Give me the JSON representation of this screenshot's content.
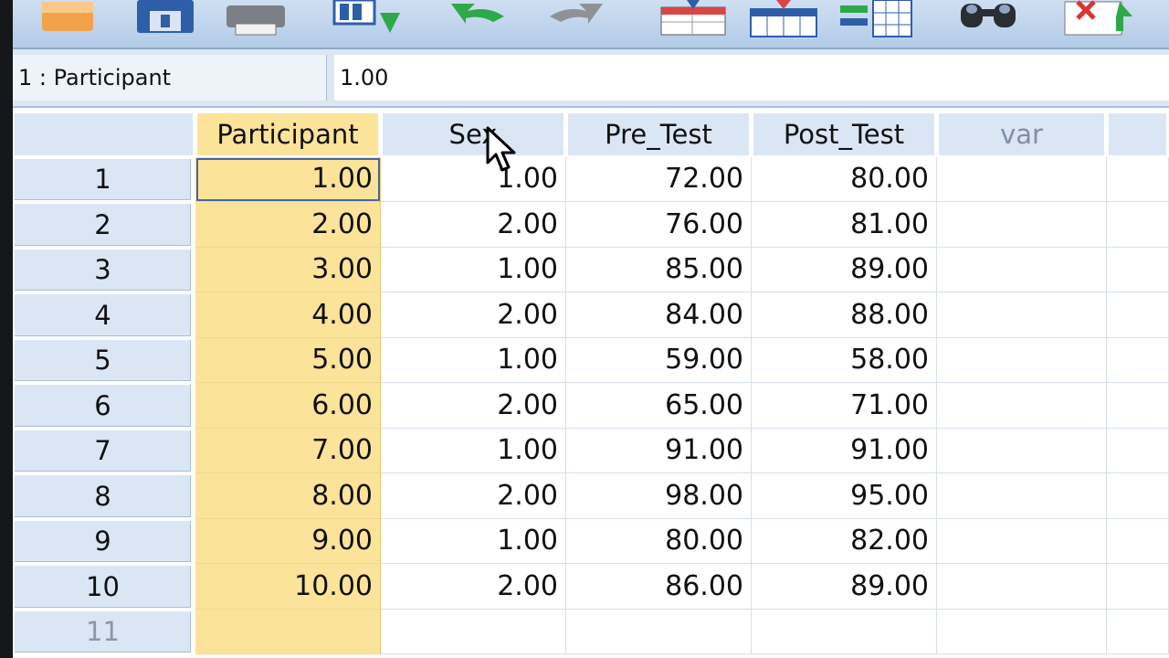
{
  "toolbar": {
    "icons": [
      "open-folder-icon",
      "save-icon",
      "print-icon",
      "recall-dialog-icon",
      "undo-icon",
      "redo-icon",
      "goto-case-icon",
      "goto-variable-icon",
      "variables-icon",
      "find-icon",
      "insert-cases-icon"
    ]
  },
  "cell_info": {
    "reference": "1 : Participant",
    "value": "1.00"
  },
  "grid": {
    "columns": [
      "Participant",
      "Sex",
      "Pre_Test",
      "Post_Test",
      "var",
      ""
    ],
    "rows": [
      {
        "num": "1",
        "cells": [
          "1.00",
          "1.00",
          "72.00",
          "80.00"
        ]
      },
      {
        "num": "2",
        "cells": [
          "2.00",
          "2.00",
          "76.00",
          "81.00"
        ]
      },
      {
        "num": "3",
        "cells": [
          "3.00",
          "1.00",
          "85.00",
          "89.00"
        ]
      },
      {
        "num": "4",
        "cells": [
          "4.00",
          "2.00",
          "84.00",
          "88.00"
        ]
      },
      {
        "num": "5",
        "cells": [
          "5.00",
          "1.00",
          "59.00",
          "58.00"
        ]
      },
      {
        "num": "6",
        "cells": [
          "6.00",
          "2.00",
          "65.00",
          "71.00"
        ]
      },
      {
        "num": "7",
        "cells": [
          "7.00",
          "1.00",
          "91.00",
          "91.00"
        ]
      },
      {
        "num": "8",
        "cells": [
          "8.00",
          "2.00",
          "98.00",
          "95.00"
        ]
      },
      {
        "num": "9",
        "cells": [
          "9.00",
          "1.00",
          "80.00",
          "82.00"
        ]
      },
      {
        "num": "10",
        "cells": [
          "10.00",
          "2.00",
          "86.00",
          "89.00"
        ]
      },
      {
        "num": "11",
        "cells": [
          "",
          "",
          "",
          ""
        ]
      }
    ]
  },
  "colors": {
    "selected_column": "#fbe39a",
    "header_bg": "#dbe6f5",
    "toolbar_bg": "#c3d6ee"
  }
}
